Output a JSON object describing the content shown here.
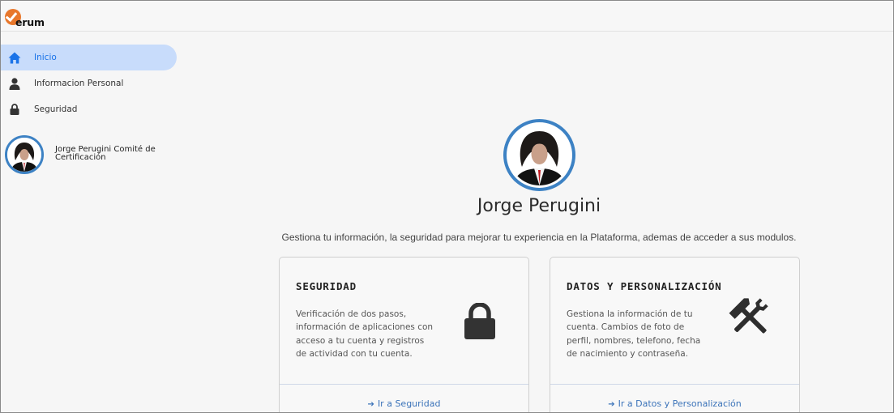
{
  "app": {
    "logo_text": "erum"
  },
  "sidebar": {
    "items": [
      {
        "label": "Inicio",
        "icon": "home-icon",
        "active": true
      },
      {
        "label": "Informacion Personal",
        "icon": "user-icon",
        "active": false
      },
      {
        "label": "Seguridad",
        "icon": "lock-icon",
        "active": false
      }
    ],
    "user": {
      "name": "Jorge Perugini Comité de Certificación"
    }
  },
  "main": {
    "profile_name": "Jorge Perugini",
    "subtitle": "Gestiona tu información, la seguridad para mejorar tu experiencia en la Plataforma, ademas de acceder a sus modulos.",
    "cards": [
      {
        "title": "SEGURIDAD",
        "description": "Verificación de dos pasos, información de aplicaciones con acceso a tu cuenta y registros de actividad con tu cuenta.",
        "icon": "lock-icon",
        "link": "Ir a Seguridad"
      },
      {
        "title": "DATOS Y PERSONALIZACIÓN",
        "description": "Gestiona la información de tu cuenta. Cambios de foto de perfil, nombres, telefono, fecha de nacimiento y contraseña.",
        "icon": "tools-icon",
        "link": "Ir a Datos y Personalización"
      }
    ]
  },
  "colors": {
    "accent": "#1a73e8",
    "active_bg": "#c8dcfb",
    "avatar_ring": "#3d82c4",
    "logo": "#e8772b",
    "link": "#3b73b9"
  }
}
